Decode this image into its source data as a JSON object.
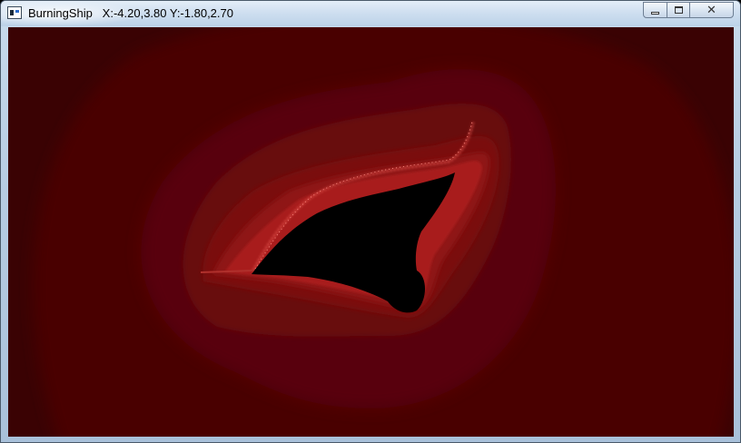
{
  "window": {
    "title": "BurningShip   X:-4.20,3.80 Y:-1.80,2.70"
  },
  "controls": {
    "minimize": "minimize",
    "maximize": "maximize",
    "close": "✕"
  },
  "fractal": {
    "name": "BurningShip",
    "x_range": [
      -4.2,
      3.8
    ],
    "y_range": [
      -1.8,
      2.7
    ],
    "colors": {
      "far": "#3a0203",
      "ring1": "#4a0405",
      "ring2": "#580607",
      "ring3": "#680909",
      "ring4": "#7a0e0d",
      "ring5": "#8f1514",
      "ring6": "#a81f1d",
      "edge": "#e0504a",
      "interior": "#000000"
    }
  }
}
